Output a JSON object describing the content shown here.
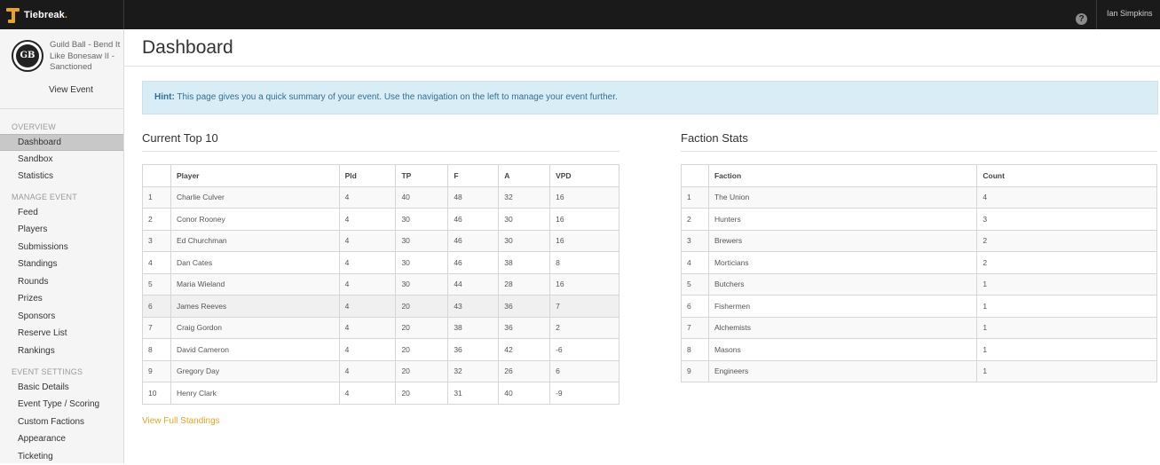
{
  "topbar": {
    "brand_name": "Tiebreak",
    "brand_dot": ".",
    "help_glyph": "?",
    "user_name": "Ian Simpkins"
  },
  "sidebar": {
    "event_logo_text": "GB",
    "event_name": "Guild Ball - Bend It Like Bonesaw II - Sanctioned",
    "view_event": "View Event",
    "sections": {
      "overview": "OVERVIEW",
      "manage": "MANAGE EVENT",
      "settings": "EVENT SETTINGS"
    },
    "overview_items": [
      "Dashboard",
      "Sandbox",
      "Statistics"
    ],
    "manage_items": [
      "Feed",
      "Players",
      "Submissions",
      "Standings",
      "Rounds",
      "Prizes",
      "Sponsors",
      "Reserve List",
      "Rankings"
    ],
    "settings_items": [
      "Basic Details",
      "Event Type / Scoring",
      "Custom Factions",
      "Appearance",
      "Ticketing"
    ]
  },
  "main": {
    "title": "Dashboard",
    "hint_label": "Hint:",
    "hint_text": " This page gives you a quick summary of your event. Use the navigation on the left to manage your event further.",
    "top10": {
      "title": "Current Top 10",
      "headers": [
        "",
        "Player",
        "Pld",
        "TP",
        "F",
        "A",
        "VPD"
      ],
      "rows": [
        [
          "1",
          "Charlie Culver",
          "4",
          "40",
          "48",
          "32",
          "16"
        ],
        [
          "2",
          "Conor Rooney",
          "4",
          "30",
          "46",
          "30",
          "16"
        ],
        [
          "3",
          "Ed Churchman",
          "4",
          "30",
          "46",
          "30",
          "16"
        ],
        [
          "4",
          "Dan Cates",
          "4",
          "30",
          "46",
          "38",
          "8"
        ],
        [
          "5",
          "Maria Wieland",
          "4",
          "30",
          "44",
          "28",
          "16"
        ],
        [
          "6",
          "James Reeves",
          "4",
          "20",
          "43",
          "36",
          "7"
        ],
        [
          "7",
          "Craig Gordon",
          "4",
          "20",
          "38",
          "36",
          "2"
        ],
        [
          "8",
          "David Cameron",
          "4",
          "20",
          "36",
          "42",
          "-6"
        ],
        [
          "9",
          "Gregory Day",
          "4",
          "20",
          "32",
          "26",
          "6"
        ],
        [
          "10",
          "Henry Clark",
          "4",
          "20",
          "31",
          "40",
          "-9"
        ]
      ],
      "view_full": "View Full Standings"
    },
    "factions": {
      "title": "Faction Stats",
      "headers": [
        "",
        "Faction",
        "Count"
      ],
      "rows": [
        [
          "1",
          "The Union",
          "4"
        ],
        [
          "2",
          "Hunters",
          "3"
        ],
        [
          "3",
          "Brewers",
          "2"
        ],
        [
          "4",
          "Morticians",
          "2"
        ],
        [
          "5",
          "Butchers",
          "1"
        ],
        [
          "6",
          "Fishermen",
          "1"
        ],
        [
          "7",
          "Alchemists",
          "1"
        ],
        [
          "8",
          "Masons",
          "1"
        ],
        [
          "9",
          "Engineers",
          "1"
        ]
      ]
    }
  },
  "colors": {
    "accent": "#e8a321",
    "topbar": "#1a1a1a",
    "hint_bg": "#d9edf7",
    "hint_text": "#31708f"
  }
}
